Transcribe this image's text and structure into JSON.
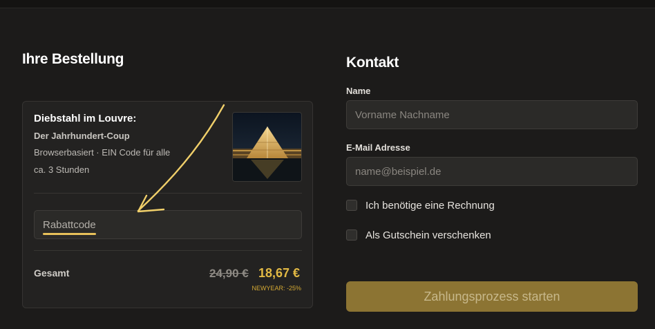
{
  "order": {
    "heading": "Ihre Bestellung",
    "product": {
      "title": "Diebstahl im Louvre:",
      "subtitle": "Der Jahrhundert-Coup",
      "info": "Browserbasiert · EIN Code für alle",
      "duration": "ca. 3 Stunden",
      "image_subject": "louvre-pyramid-night"
    },
    "coupon": {
      "placeholder": "Rabattcode"
    },
    "total": {
      "label": "Gesamt",
      "old_price": "24,90 €",
      "new_price": "18,67 €",
      "discount_note": "NEWYEAR: -25%"
    }
  },
  "contact": {
    "heading": "Kontakt",
    "name_label": "Name",
    "name_placeholder": "Vorname Nachname",
    "email_label": "E-Mail Adresse",
    "email_placeholder": "name@beispiel.de",
    "invoice_checkbox": "Ich benötige eine Rechnung",
    "gift_checkbox": "Als Gutschein verschenken",
    "submit_label": "Zahlungsprozess starten"
  },
  "colors": {
    "accent": "#e2b944",
    "button": "#8c7433",
    "background": "#1c1b1a",
    "card": "#232221"
  }
}
